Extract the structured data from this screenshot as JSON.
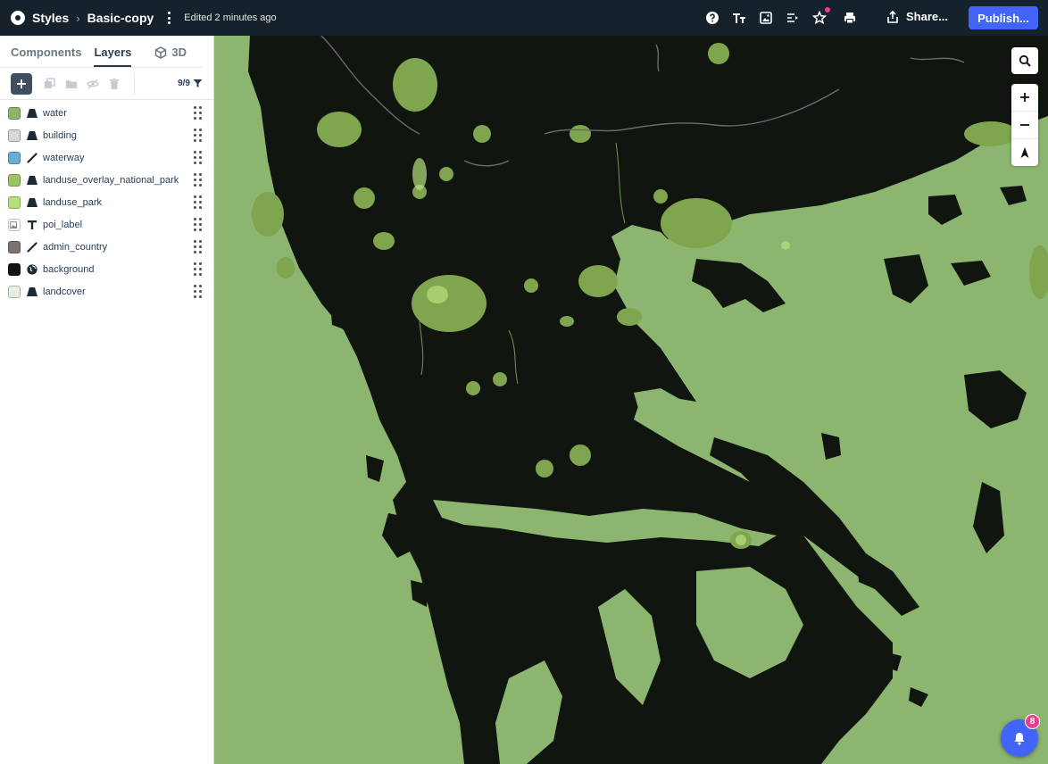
{
  "header": {
    "breadcrumb_root": "Styles",
    "style_name": "Basic-copy",
    "edited_status": "Edited 2 minutes ago",
    "share_label": "Share...",
    "publish_label": "Publish...",
    "icons": [
      "help-icon",
      "typography-icon",
      "image-icon",
      "legend-icon",
      "extensions-icon",
      "print-icon",
      "share-icon"
    ],
    "accent_color": "#4264fb"
  },
  "sidebar": {
    "tabs": [
      {
        "label": "Components",
        "active": false
      },
      {
        "label": "Layers",
        "active": true
      },
      {
        "label": "3D",
        "active": false
      }
    ],
    "layer_count": "9/9",
    "layers": [
      {
        "name": "water",
        "color": "#8cb56f",
        "type_icon": "fill-icon"
      },
      {
        "name": "building",
        "color": "#d9d9d9",
        "type_icon": "fill-icon"
      },
      {
        "name": "waterway",
        "color": "#6aaed6",
        "type_icon": "line-icon"
      },
      {
        "name": "landuse_overlay_national_park",
        "color": "#9cc364",
        "type_icon": "fill-icon"
      },
      {
        "name": "landuse_park",
        "color": "#b8df7d",
        "type_icon": "fill-icon"
      },
      {
        "name": "poi_label",
        "color": "#ffffff",
        "type_icon": "symbol-icon"
      },
      {
        "name": "admin_country",
        "color": "#7a7370",
        "type_icon": "line-icon"
      },
      {
        "name": "background",
        "color": "#10160f",
        "type_icon": "globe-icon"
      },
      {
        "name": "landcover",
        "color": "#e6eee2",
        "type_icon": "fill-icon"
      }
    ]
  },
  "map": {
    "water_color": "#8cb56f",
    "land_color": "#10160f",
    "park_color": "#7fa54f",
    "controls": [
      "search-icon",
      "zoom-in-icon",
      "zoom-out-icon",
      "compass-icon"
    ]
  },
  "notifications": {
    "count": "8"
  }
}
